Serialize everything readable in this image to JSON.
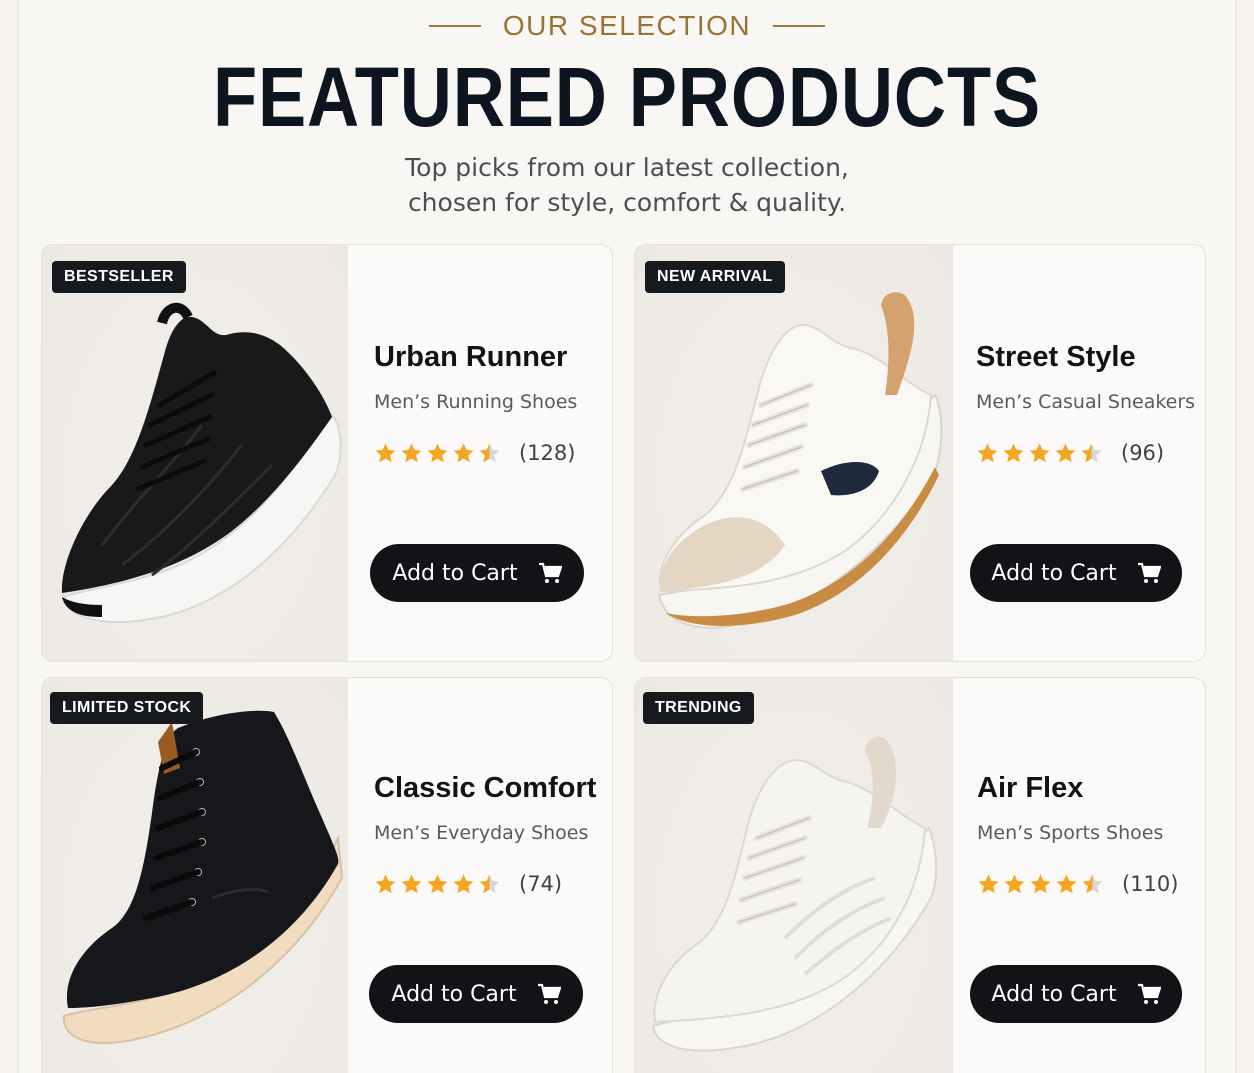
{
  "header": {
    "eyebrow": "OUR SELECTION",
    "title": "FEATURED PRODUCTS",
    "subtitle_line1": "Top picks from our latest collection,",
    "subtitle_line2": "chosen for style, comfort & quality."
  },
  "colors": {
    "accent": "#a17a3e",
    "star": "#f4a623",
    "button": "#111316",
    "badge": "#16191d"
  },
  "products": [
    {
      "badge": "BESTSELLER",
      "name": "Urban Runner",
      "category": "Men’s Running Shoes",
      "rating": 4.5,
      "reviews": "(128)",
      "cart_label": "Add to Cart",
      "image": "black-knit-running-shoe"
    },
    {
      "badge": "NEW ARRIVAL",
      "name": "Street Style",
      "category": "Men’s Casual Sneakers",
      "rating": 4.5,
      "reviews": "(96)",
      "cart_label": "Add to Cart",
      "image": "white-beige-casual-sneaker"
    },
    {
      "badge": "LIMITED STOCK",
      "name": "Classic Comfort",
      "category": "Men’s Everyday Shoes",
      "rating": 4.5,
      "reviews": "(74)",
      "cart_label": "Add to Cart",
      "image": "black-high-top-sneaker"
    },
    {
      "badge": "TRENDING",
      "name": "Air Flex",
      "category": "Men’s Sports Shoes",
      "rating": 4.5,
      "reviews": "(110)",
      "cart_label": "Add to Cart",
      "image": "white-knit-sports-shoe"
    }
  ]
}
